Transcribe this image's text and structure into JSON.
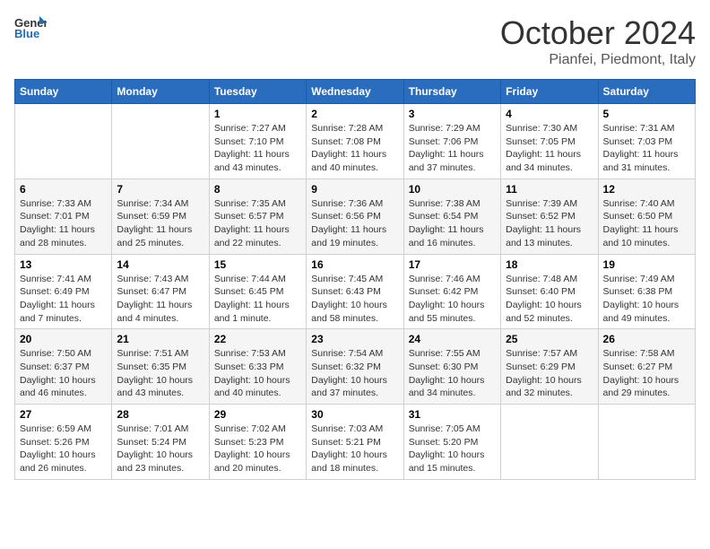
{
  "header": {
    "logo_general": "General",
    "logo_blue": "Blue",
    "title": "October 2024",
    "location": "Pianfei, Piedmont, Italy"
  },
  "weekdays": [
    "Sunday",
    "Monday",
    "Tuesday",
    "Wednesday",
    "Thursday",
    "Friday",
    "Saturday"
  ],
  "weeks": [
    [
      {
        "day": null,
        "sunrise": null,
        "sunset": null,
        "daylight": null
      },
      {
        "day": null,
        "sunrise": null,
        "sunset": null,
        "daylight": null
      },
      {
        "day": "1",
        "sunrise": "7:27 AM",
        "sunset": "7:10 PM",
        "daylight": "11 hours and 43 minutes."
      },
      {
        "day": "2",
        "sunrise": "7:28 AM",
        "sunset": "7:08 PM",
        "daylight": "11 hours and 40 minutes."
      },
      {
        "day": "3",
        "sunrise": "7:29 AM",
        "sunset": "7:06 PM",
        "daylight": "11 hours and 37 minutes."
      },
      {
        "day": "4",
        "sunrise": "7:30 AM",
        "sunset": "7:05 PM",
        "daylight": "11 hours and 34 minutes."
      },
      {
        "day": "5",
        "sunrise": "7:31 AM",
        "sunset": "7:03 PM",
        "daylight": "11 hours and 31 minutes."
      }
    ],
    [
      {
        "day": "6",
        "sunrise": "7:33 AM",
        "sunset": "7:01 PM",
        "daylight": "11 hours and 28 minutes."
      },
      {
        "day": "7",
        "sunrise": "7:34 AM",
        "sunset": "6:59 PM",
        "daylight": "11 hours and 25 minutes."
      },
      {
        "day": "8",
        "sunrise": "7:35 AM",
        "sunset": "6:57 PM",
        "daylight": "11 hours and 22 minutes."
      },
      {
        "day": "9",
        "sunrise": "7:36 AM",
        "sunset": "6:56 PM",
        "daylight": "11 hours and 19 minutes."
      },
      {
        "day": "10",
        "sunrise": "7:38 AM",
        "sunset": "6:54 PM",
        "daylight": "11 hours and 16 minutes."
      },
      {
        "day": "11",
        "sunrise": "7:39 AM",
        "sunset": "6:52 PM",
        "daylight": "11 hours and 13 minutes."
      },
      {
        "day": "12",
        "sunrise": "7:40 AM",
        "sunset": "6:50 PM",
        "daylight": "11 hours and 10 minutes."
      }
    ],
    [
      {
        "day": "13",
        "sunrise": "7:41 AM",
        "sunset": "6:49 PM",
        "daylight": "11 hours and 7 minutes."
      },
      {
        "day": "14",
        "sunrise": "7:43 AM",
        "sunset": "6:47 PM",
        "daylight": "11 hours and 4 minutes."
      },
      {
        "day": "15",
        "sunrise": "7:44 AM",
        "sunset": "6:45 PM",
        "daylight": "11 hours and 1 minute."
      },
      {
        "day": "16",
        "sunrise": "7:45 AM",
        "sunset": "6:43 PM",
        "daylight": "10 hours and 58 minutes."
      },
      {
        "day": "17",
        "sunrise": "7:46 AM",
        "sunset": "6:42 PM",
        "daylight": "10 hours and 55 minutes."
      },
      {
        "day": "18",
        "sunrise": "7:48 AM",
        "sunset": "6:40 PM",
        "daylight": "10 hours and 52 minutes."
      },
      {
        "day": "19",
        "sunrise": "7:49 AM",
        "sunset": "6:38 PM",
        "daylight": "10 hours and 49 minutes."
      }
    ],
    [
      {
        "day": "20",
        "sunrise": "7:50 AM",
        "sunset": "6:37 PM",
        "daylight": "10 hours and 46 minutes."
      },
      {
        "day": "21",
        "sunrise": "7:51 AM",
        "sunset": "6:35 PM",
        "daylight": "10 hours and 43 minutes."
      },
      {
        "day": "22",
        "sunrise": "7:53 AM",
        "sunset": "6:33 PM",
        "daylight": "10 hours and 40 minutes."
      },
      {
        "day": "23",
        "sunrise": "7:54 AM",
        "sunset": "6:32 PM",
        "daylight": "10 hours and 37 minutes."
      },
      {
        "day": "24",
        "sunrise": "7:55 AM",
        "sunset": "6:30 PM",
        "daylight": "10 hours and 34 minutes."
      },
      {
        "day": "25",
        "sunrise": "7:57 AM",
        "sunset": "6:29 PM",
        "daylight": "10 hours and 32 minutes."
      },
      {
        "day": "26",
        "sunrise": "7:58 AM",
        "sunset": "6:27 PM",
        "daylight": "10 hours and 29 minutes."
      }
    ],
    [
      {
        "day": "27",
        "sunrise": "6:59 AM",
        "sunset": "5:26 PM",
        "daylight": "10 hours and 26 minutes."
      },
      {
        "day": "28",
        "sunrise": "7:01 AM",
        "sunset": "5:24 PM",
        "daylight": "10 hours and 23 minutes."
      },
      {
        "day": "29",
        "sunrise": "7:02 AM",
        "sunset": "5:23 PM",
        "daylight": "10 hours and 20 minutes."
      },
      {
        "day": "30",
        "sunrise": "7:03 AM",
        "sunset": "5:21 PM",
        "daylight": "10 hours and 18 minutes."
      },
      {
        "day": "31",
        "sunrise": "7:05 AM",
        "sunset": "5:20 PM",
        "daylight": "10 hours and 15 minutes."
      },
      {
        "day": null,
        "sunrise": null,
        "sunset": null,
        "daylight": null
      },
      {
        "day": null,
        "sunrise": null,
        "sunset": null,
        "daylight": null
      }
    ]
  ]
}
